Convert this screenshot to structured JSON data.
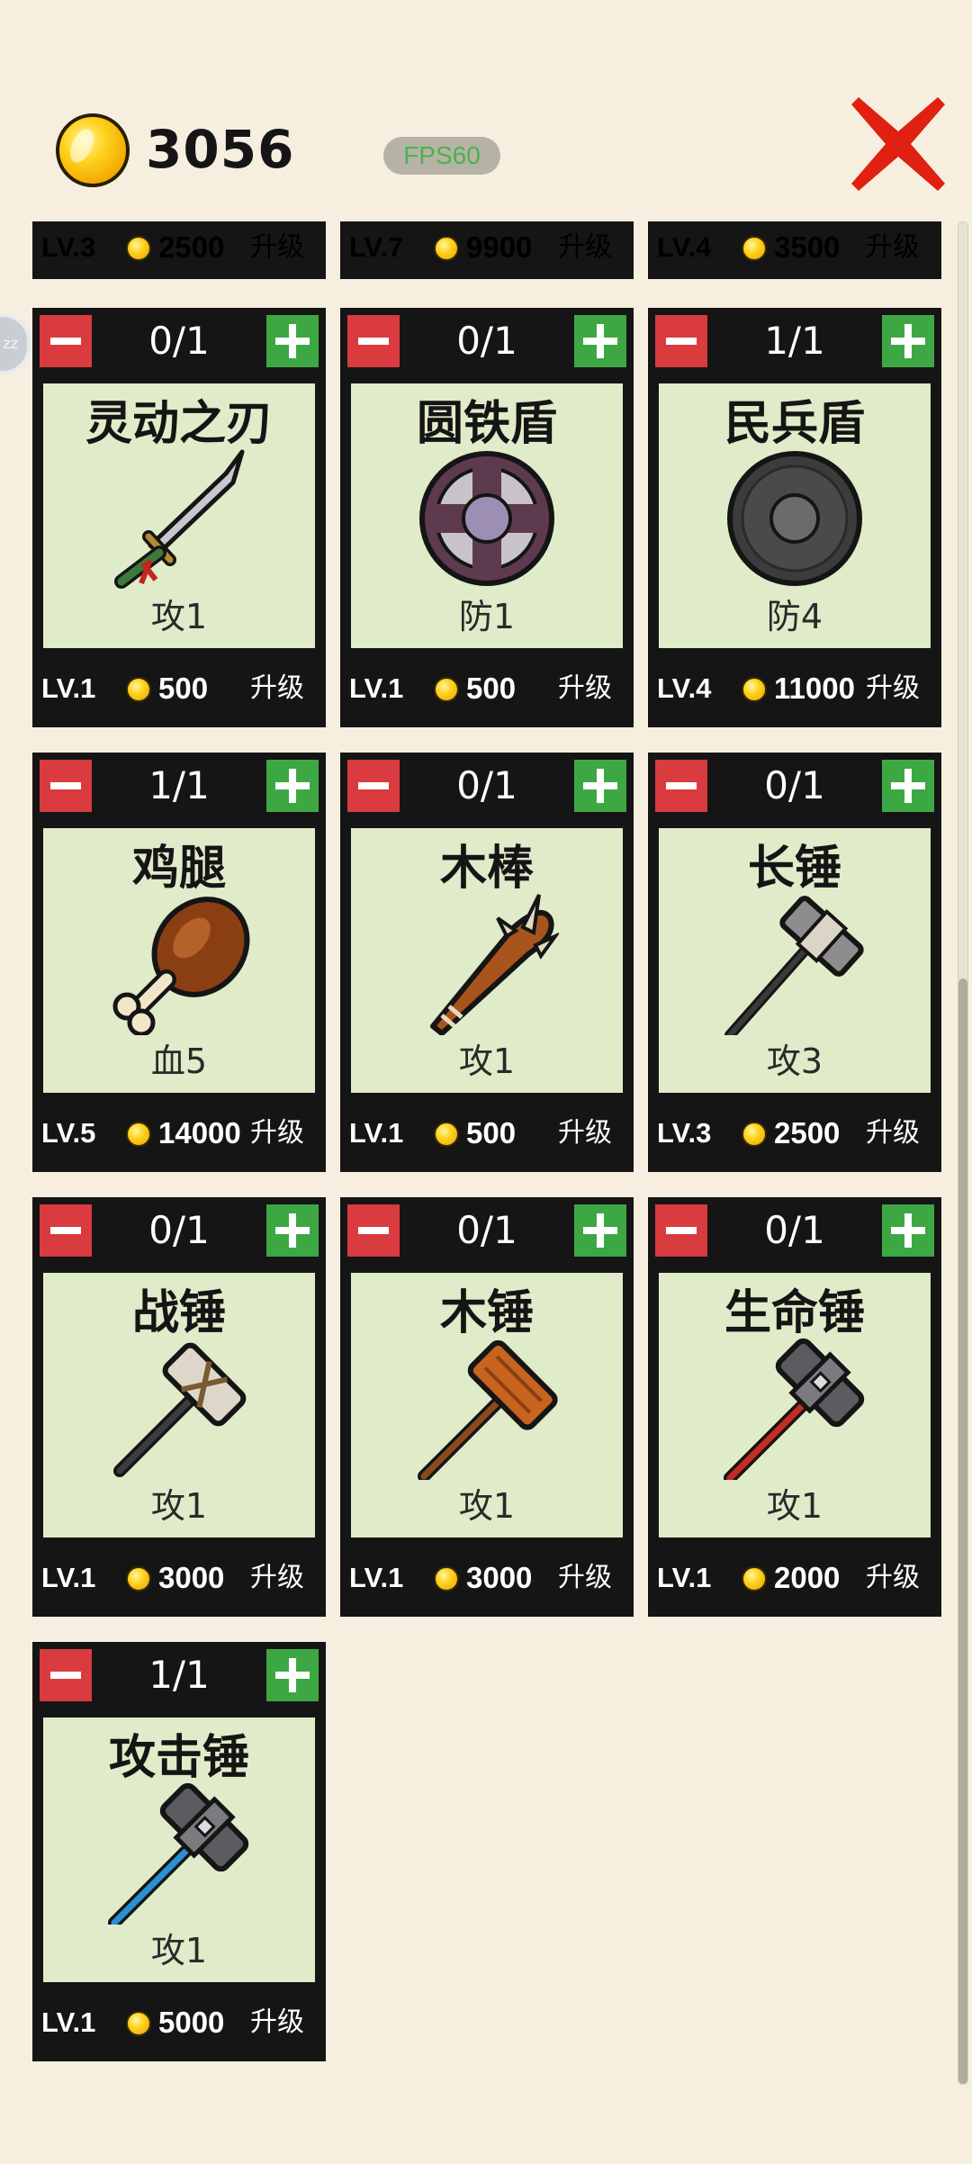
{
  "header": {
    "coins": "3056",
    "fps": "FPS60",
    "side_tab": "zz"
  },
  "colors": {
    "background": "#f6efe0",
    "card": "#151515",
    "card_body": "#e0ebc9",
    "minus": "#d93b3f",
    "plus": "#3da843",
    "close": "#e02010",
    "fps_text": "#49b34a"
  },
  "top_row": [
    {
      "level": "LV.3",
      "price": "2500",
      "upgrade": "升级"
    },
    {
      "level": "LV.7",
      "price": "9900",
      "upgrade": "升级"
    },
    {
      "level": "LV.4",
      "price": "3500",
      "upgrade": "升级"
    }
  ],
  "items": [
    {
      "count": "0/1",
      "name": "灵动之刃",
      "icon": "sword-icon",
      "stat": "攻1",
      "level": "LV.1",
      "price": "500",
      "upgrade": "升级"
    },
    {
      "count": "0/1",
      "name": "圆铁盾",
      "icon": "round-iron-shield-icon",
      "stat": "防1",
      "level": "LV.1",
      "price": "500",
      "upgrade": "升级"
    },
    {
      "count": "1/1",
      "name": "民兵盾",
      "icon": "militia-shield-icon",
      "stat": "防4",
      "level": "LV.4",
      "price": "11000",
      "upgrade": "升级"
    },
    {
      "count": "1/1",
      "name": "鸡腿",
      "icon": "drumstick-icon",
      "stat": "血5",
      "level": "LV.5",
      "price": "14000",
      "upgrade": "升级"
    },
    {
      "count": "0/1",
      "name": "木棒",
      "icon": "club-icon",
      "stat": "攻1",
      "level": "LV.1",
      "price": "500",
      "upgrade": "升级"
    },
    {
      "count": "0/1",
      "name": "长锤",
      "icon": "long-hammer-icon",
      "stat": "攻3",
      "level": "LV.3",
      "price": "2500",
      "upgrade": "升级"
    },
    {
      "count": "0/1",
      "name": "战锤",
      "icon": "war-hammer-icon",
      "stat": "攻1",
      "level": "LV.1",
      "price": "3000",
      "upgrade": "升级"
    },
    {
      "count": "0/1",
      "name": "木锤",
      "icon": "wooden-hammer-icon",
      "stat": "攻1",
      "level": "LV.1",
      "price": "3000",
      "upgrade": "升级"
    },
    {
      "count": "0/1",
      "name": "生命锤",
      "icon": "life-hammer-icon",
      "stat": "攻1",
      "level": "LV.1",
      "price": "2000",
      "upgrade": "升级"
    },
    {
      "count": "1/1",
      "name": "攻击锤",
      "icon": "attack-hammer-icon",
      "stat": "攻1",
      "level": "LV.1",
      "price": "5000",
      "upgrade": "升级"
    }
  ]
}
